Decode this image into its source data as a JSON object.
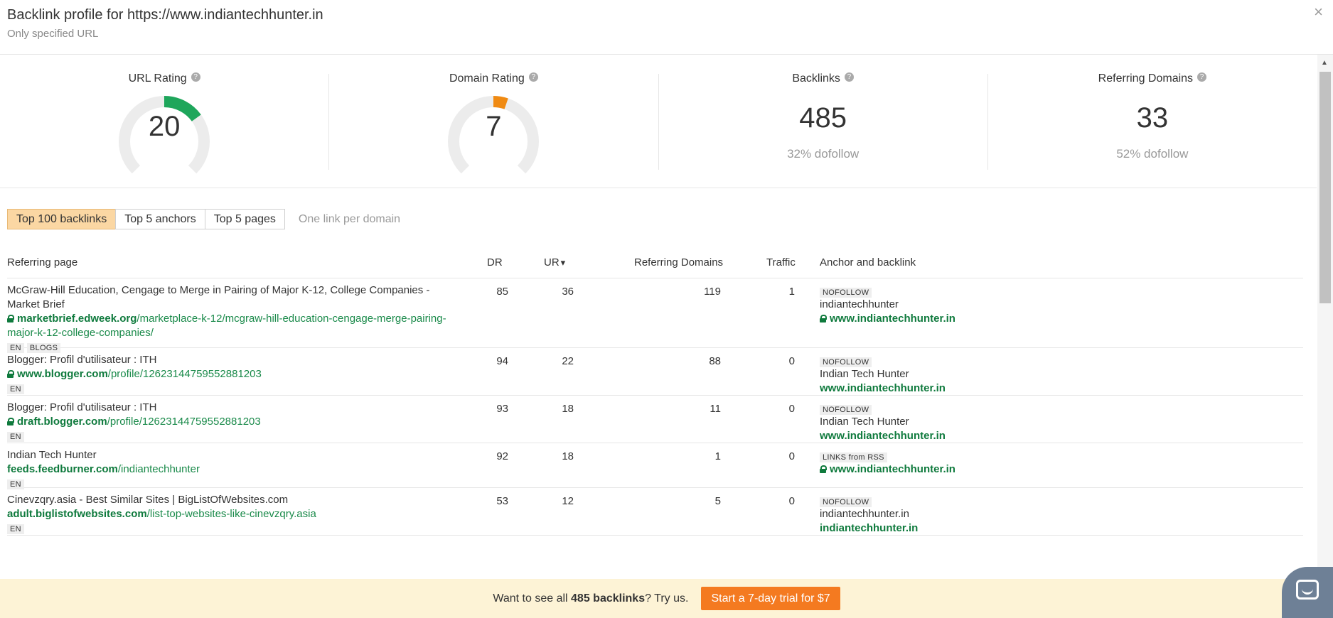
{
  "header": {
    "title": "Backlink profile for https://www.indiantechhunter.in",
    "subtitle": "Only specified URL",
    "close_label": "×"
  },
  "metrics": {
    "url_rating": {
      "label": "URL Rating",
      "value": "20",
      "score": 20,
      "color": "#1ea65b"
    },
    "domain_rating": {
      "label": "Domain Rating",
      "value": "7",
      "score": 7,
      "color": "#f08a12"
    },
    "backlinks": {
      "label": "Backlinks",
      "value": "485",
      "note": "32% dofollow"
    },
    "referring_domains": {
      "label": "Referring Domains",
      "value": "33",
      "note": "52% dofollow"
    },
    "help_icon": "?"
  },
  "tabs": {
    "items": [
      "Top 100 backlinks",
      "Top 5 anchors",
      "Top 5 pages"
    ],
    "active": 0,
    "one_link": "One link per domain"
  },
  "table": {
    "headers": {
      "referring_page": "Referring page",
      "dr": "DR",
      "ur": "UR",
      "ur_sort": "▾",
      "referring_domains": "Referring Domains",
      "traffic": "Traffic",
      "anchor": "Anchor and backlink"
    },
    "rows": [
      {
        "title": "McGraw-Hill Education, Cengage to Merge in Pairing of Major K-12, College Companies - Market Brief",
        "secure": true,
        "domain": "marketbrief.edweek.org",
        "path": "/marketplace-k-12/mcgraw-hill-education-cengage-merge-pairing-major-k-12-college-companies/",
        "tags": [
          "EN",
          "BLOGS"
        ],
        "dr": "85",
        "ur": "36",
        "rd": "119",
        "traffic": "1",
        "anchor_tag": "NOFOLLOW",
        "anchor_text": "indiantechhunter",
        "anchor_secure": true,
        "anchor_url": "www.indiantechhunter.in"
      },
      {
        "title": "Blogger: Profil d'utilisateur : ITH",
        "secure": true,
        "domain": "www.blogger.com",
        "path": "/profile/12623144759552881203",
        "tags": [
          "EN"
        ],
        "dr": "94",
        "ur": "22",
        "rd": "88",
        "traffic": "0",
        "anchor_tag": "NOFOLLOW",
        "anchor_text": "Indian Tech Hunter",
        "anchor_secure": false,
        "anchor_url": "www.indiantechhunter.in"
      },
      {
        "title": "Blogger: Profil d'utilisateur : ITH",
        "secure": true,
        "domain": "draft.blogger.com",
        "path": "/profile/12623144759552881203",
        "tags": [
          "EN"
        ],
        "dr": "93",
        "ur": "18",
        "rd": "11",
        "traffic": "0",
        "anchor_tag": "NOFOLLOW",
        "anchor_text": "Indian Tech Hunter",
        "anchor_secure": false,
        "anchor_url": "www.indiantechhunter.in"
      },
      {
        "title": "Indian Tech Hunter",
        "secure": false,
        "domain": "feeds.feedburner.com",
        "path": "/indiantechhunter",
        "tags": [
          "EN"
        ],
        "dr": "92",
        "ur": "18",
        "rd": "1",
        "traffic": "0",
        "anchor_tag": "LINKS from RSS",
        "anchor_text": "",
        "anchor_secure": true,
        "anchor_url": "www.indiantechhunter.in"
      },
      {
        "title": "Cinevzqry.asia - Best Similar Sites | BigListOfWebsites.com",
        "secure": false,
        "domain": "adult.biglistofwebsites.com",
        "path": "/list-top-websites-like-cinevzqry.asia",
        "tags": [
          "EN"
        ],
        "dr": "53",
        "ur": "12",
        "rd": "5",
        "traffic": "0",
        "anchor_tag": "NOFOLLOW",
        "anchor_text": "indiantechhunter.in",
        "anchor_secure": false,
        "anchor_url": "indiantechhunter.in"
      }
    ]
  },
  "footer": {
    "text_before": "Want to see all ",
    "text_bold": "485 backlinks",
    "text_after": "? Try us.",
    "cta": "Start a 7-day trial for $7"
  }
}
